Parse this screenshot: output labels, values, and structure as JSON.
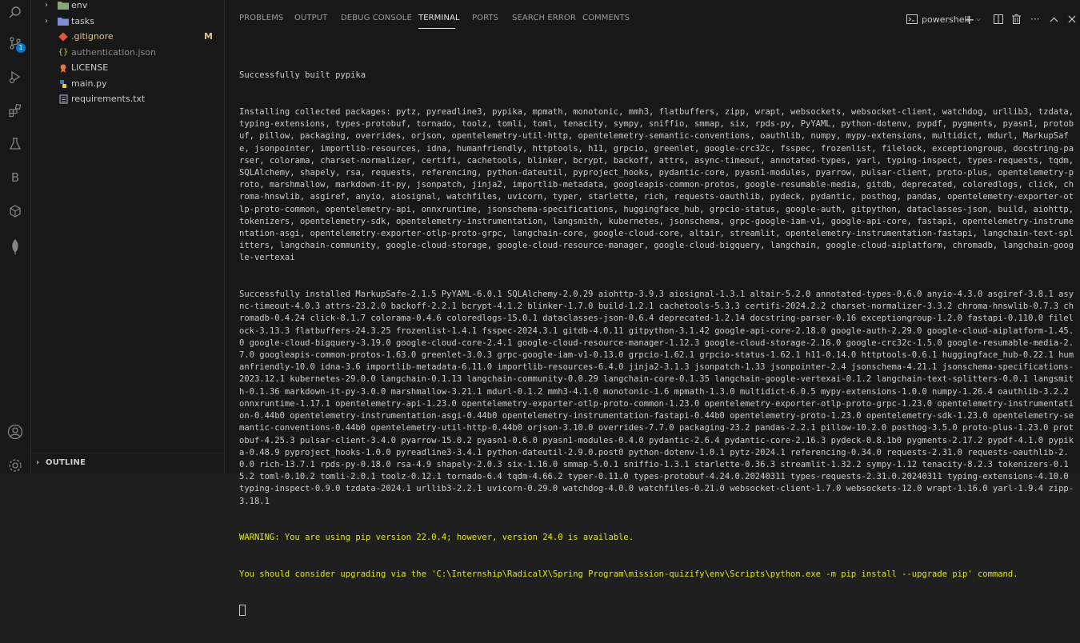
{
  "activity_bar": {
    "source_control_badge": "1"
  },
  "explorer": {
    "items": [
      {
        "label": "env",
        "kind": "folder",
        "modified": ""
      },
      {
        "label": "tasks",
        "kind": "folder",
        "modified": ""
      },
      {
        "label": ".gitignore",
        "kind": "file",
        "modified": "M"
      },
      {
        "label": "authentication.json",
        "kind": "file",
        "modified": ""
      },
      {
        "label": "LICENSE",
        "kind": "file",
        "modified": ""
      },
      {
        "label": "main.py",
        "kind": "file",
        "modified": ""
      },
      {
        "label": "requirements.txt",
        "kind": "file",
        "modified": ""
      }
    ],
    "outline_label": "OUTLINE"
  },
  "panel": {
    "tabs": [
      "PROBLEMS",
      "OUTPUT",
      "DEBUG CONSOLE",
      "TERMINAL",
      "PORTS",
      "SEARCH ERROR",
      "COMMENTS"
    ],
    "active_tab": "TERMINAL",
    "shell_label": "powershell",
    "terminal": {
      "built": "Successfully built pypika",
      "collecting": "Installing collected packages: pytz, pyreadline3, pypika, mpmath, monotonic, mmh3, flatbuffers, zipp, wrapt, websockets, websocket-client, watchdog, urllib3, tzdata, typing-extensions, types-protobuf, tornado, toolz, tomli, toml, tenacity, sympy, sniffio, smmap, six, rpds-py, PyYAML, python-dotenv, pypdf, pygments, pyasn1, protobuf, pillow, packaging, overrides, orjson, opentelemetry-util-http, opentelemetry-semantic-conventions, oauthlib, numpy, mypy-extensions, multidict, mdurl, MarkupSafe, jsonpointer, importlib-resources, idna, humanfriendly, httptools, h11, grpcio, greenlet, google-crc32c, fsspec, frozenlist, filelock, exceptiongroup, docstring-parser, colorama, charset-normalizer, certifi, cachetools, blinker, bcrypt, backoff, attrs, async-timeout, annotated-types, yarl, typing-inspect, types-requests, tqdm, SQLAlchemy, shapely, rsa, requests, referencing, python-dateutil, pyproject_hooks, pydantic-core, pyasn1-modules, pyarrow, pulsar-client, proto-plus, opentelemetry-proto, marshmallow, markdown-it-py, jsonpatch, jinja2, importlib-metadata, googleapis-common-protos, google-resumable-media, gitdb, deprecated, coloredlogs, click, chroma-hnswlib, asgiref, anyio, aiosignal, watchfiles, uvicorn, typer, starlette, rich, requests-oauthlib, pydeck, pydantic, posthog, pandas, opentelemetry-exporter-otlp-proto-common, opentelemetry-api, onnxruntime, jsonschema-specifications, huggingface_hub, grpcio-status, google-auth, gitpython, dataclasses-json, build, aiohttp, tokenizers, opentelemetry-sdk, opentelemetry-instrumentation, langsmith, kubernetes, jsonschema, grpc-google-iam-v1, google-api-core, fastapi, opentelemetry-instrumentation-asgi, opentelemetry-exporter-otlp-proto-grpc, langchain-core, google-cloud-core, altair, streamlit, opentelemetry-instrumentation-fastapi, langchain-text-splitters, langchain-community, google-cloud-storage, google-cloud-resource-manager, google-cloud-bigquery, langchain, google-cloud-aiplatform, chromadb, langchain-google-vertexai",
      "installed": "Successfully installed MarkupSafe-2.1.5 PyYAML-6.0.1 SQLAlchemy-2.0.29 aiohttp-3.9.3 aiosignal-1.3.1 altair-5.2.0 annotated-types-0.6.0 anyio-4.3.0 asgiref-3.8.1 async-timeout-4.0.3 attrs-23.2.0 backoff-2.2.1 bcrypt-4.1.2 blinker-1.7.0 build-1.2.1 cachetools-5.3.3 certifi-2024.2.2 charset-normalizer-3.3.2 chroma-hnswlib-0.7.3 chromadb-0.4.24 click-8.1.7 colorama-0.4.6 coloredlogs-15.0.1 dataclasses-json-0.6.4 deprecated-1.2.14 docstring-parser-0.16 exceptiongroup-1.2.0 fastapi-0.110.0 filelock-3.13.3 flatbuffers-24.3.25 frozenlist-1.4.1 fsspec-2024.3.1 gitdb-4.0.11 gitpython-3.1.42 google-api-core-2.18.0 google-auth-2.29.0 google-cloud-aiplatform-1.45.0 google-cloud-bigquery-3.19.0 google-cloud-core-2.4.1 google-cloud-resource-manager-1.12.3 google-cloud-storage-2.16.0 google-crc32c-1.5.0 google-resumable-media-2.7.0 googleapis-common-protos-1.63.0 greenlet-3.0.3 grpc-google-iam-v1-0.13.0 grpcio-1.62.1 grpcio-status-1.62.1 h11-0.14.0 httptools-0.6.1 huggingface_hub-0.22.1 humanfriendly-10.0 idna-3.6 importlib-metadata-6.11.0 importlib-resources-6.4.0 jinja2-3.1.3 jsonpatch-1.33 jsonpointer-2.4 jsonschema-4.21.1 jsonschema-specifications-2023.12.1 kubernetes-29.0.0 langchain-0.1.13 langchain-community-0.0.29 langchain-core-0.1.35 langchain-google-vertexai-0.1.2 langchain-text-splitters-0.0.1 langsmith-0.1.36 markdown-it-py-3.0.0 marshmallow-3.21.1 mdurl-0.1.2 mmh3-4.1.0 monotonic-1.6 mpmath-1.3.0 multidict-6.0.5 mypy-extensions-1.0.0 numpy-1.26.4 oauthlib-3.2.2 onnxruntime-1.17.1 opentelemetry-api-1.23.0 opentelemetry-exporter-otlp-proto-common-1.23.0 opentelemetry-exporter-otlp-proto-grpc-1.23.0 opentelemetry-instrumentation-0.44b0 opentelemetry-instrumentation-asgi-0.44b0 opentelemetry-instrumentation-fastapi-0.44b0 opentelemetry-proto-1.23.0 opentelemetry-sdk-1.23.0 opentelemetry-semantic-conventions-0.44b0 opentelemetry-util-http-0.44b0 orjson-3.10.0 overrides-7.7.0 packaging-23.2 pandas-2.2.1 pillow-10.2.0 posthog-3.5.0 proto-plus-1.23.0 protobuf-4.25.3 pulsar-client-3.4.0 pyarrow-15.0.2 pyasn1-0.6.0 pyasn1-modules-0.4.0 pydantic-2.6.4 pydantic-core-2.16.3 pydeck-0.8.1b0 pygments-2.17.2 pypdf-4.1.0 pypika-0.48.9 pyproject_hooks-1.0.0 pyreadline3-3.4.1 python-dateutil-2.9.0.post0 python-dotenv-1.0.1 pytz-2024.1 referencing-0.34.0 requests-2.31.0 requests-oauthlib-2.0.0 rich-13.7.1 rpds-py-0.18.0 rsa-4.9 shapely-2.0.3 six-1.16.0 smmap-5.0.1 sniffio-1.3.1 starlette-0.36.3 streamlit-1.32.2 sympy-1.12 tenacity-8.2.3 tokenizers-0.15.2 toml-0.10.2 tomli-2.0.1 toolz-0.12.1 tornado-6.4 tqdm-4.66.2 typer-0.11.0 types-protobuf-4.24.0.20240311 types-requests-2.31.0.20240311 typing-extensions-4.10.0 typing-inspect-0.9.0 tzdata-2024.1 urllib3-2.2.1 uvicorn-0.29.0 watchdog-4.0.0 watchfiles-0.21.0 websocket-client-1.7.0 websockets-12.0 wrapt-1.16.0 yarl-1.9.4 zipp-3.18.1",
      "warning1": "WARNING: You are using pip version 22.0.4; however, version 24.0 is available.",
      "warning2": "You should consider upgrading via the 'C:\\Internship\\RadicalX\\Spring Program\\mission-quizify\\env\\Scripts\\python.exe -m pip install --upgrade pip' command."
    }
  },
  "colors": {
    "background": "#181818",
    "warning": "#e5e510",
    "modified": "#e2c08d",
    "accent": "#0078d4"
  }
}
